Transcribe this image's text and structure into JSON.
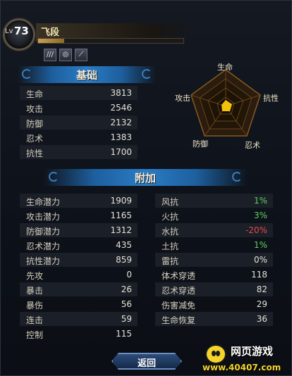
{
  "header": {
    "level_prefix": "Lv",
    "level": "73",
    "name": "飞段",
    "exp_progress": 0.18,
    "skill_icons": [
      "claw-icon",
      "eye-icon",
      "needle-icon"
    ]
  },
  "basic": {
    "title": "基础",
    "stats": [
      {
        "label": "生命",
        "value": "3813"
      },
      {
        "label": "攻击",
        "value": "2546"
      },
      {
        "label": "防御",
        "value": "2132"
      },
      {
        "label": "忍术",
        "value": "1383"
      },
      {
        "label": "抗性",
        "value": "1700"
      }
    ]
  },
  "radar": {
    "labels": {
      "top": "生命",
      "right": "抗性",
      "bottom_right": "忍术",
      "bottom_left": "防御",
      "left": "攻击"
    },
    "fill_color": "#f4c20a"
  },
  "extra": {
    "title": "附加",
    "left": [
      {
        "label": "生命潜力",
        "value": "1909"
      },
      {
        "label": "攻击潜力",
        "value": "1165"
      },
      {
        "label": "防御潜力",
        "value": "1312"
      },
      {
        "label": "忍术潜力",
        "value": "435"
      },
      {
        "label": "抗性潜力",
        "value": "859"
      },
      {
        "label": "先攻",
        "value": "0"
      },
      {
        "label": "暴击",
        "value": "26"
      },
      {
        "label": "暴伤",
        "value": "56"
      },
      {
        "label": "连击",
        "value": "59"
      },
      {
        "label": "控制",
        "value": "115"
      }
    ],
    "right": [
      {
        "label": "风抗",
        "value": "1%",
        "color": "green"
      },
      {
        "label": "火抗",
        "value": "3%",
        "color": "green"
      },
      {
        "label": "水抗",
        "value": "-20%",
        "color": "red"
      },
      {
        "label": "土抗",
        "value": "1%",
        "color": "green"
      },
      {
        "label": "雷抗",
        "value": "0%",
        "color": "white"
      },
      {
        "label": "体术穿透",
        "value": "118",
        "color": "white"
      },
      {
        "label": "忍术穿透",
        "value": "82",
        "color": "white"
      },
      {
        "label": "伤害减免",
        "value": "29",
        "color": "white"
      },
      {
        "label": "生命恢复",
        "value": "36",
        "color": "white"
      }
    ]
  },
  "buttons": {
    "back": "返回"
  },
  "watermark": {
    "title": "网页游戏",
    "url": "www.40407.com"
  }
}
